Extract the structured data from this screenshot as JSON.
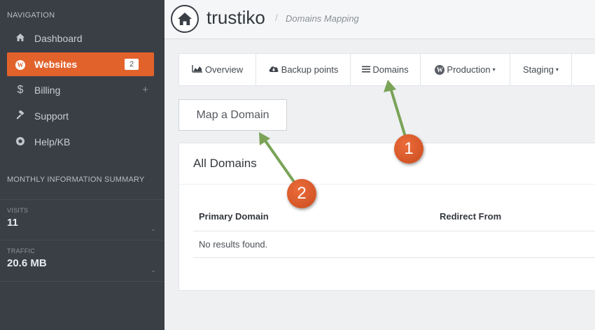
{
  "sidebar": {
    "nav_label": "NAVIGATION",
    "items": [
      {
        "label": "Dashboard",
        "icon": "home-icon"
      },
      {
        "label": "Websites",
        "icon": "wordpress-icon",
        "badge": "2",
        "active": true
      },
      {
        "label": "Billing",
        "icon": "dollar-icon",
        "extra": "+"
      },
      {
        "label": "Support",
        "icon": "gavel-icon"
      },
      {
        "label": "Help/KB",
        "icon": "help-icon"
      }
    ],
    "summary_label": "MONTHLY INFORMATION SUMMARY",
    "stats": [
      {
        "label": "VISITS",
        "value": "11",
        "trend": "-"
      },
      {
        "label": "TRAFFIC",
        "value": "20.6 MB",
        "trend": "-"
      }
    ]
  },
  "header": {
    "brand": "trustiko",
    "separator": "/",
    "breadcrumb": "Domains Mapping"
  },
  "tabs": [
    {
      "label": "Overview",
      "icon": "chart-icon"
    },
    {
      "label": "Backup points",
      "icon": "cloud-download-icon"
    },
    {
      "label": "Domains",
      "icon": "list-icon"
    },
    {
      "label": "Production",
      "icon": "wordpress-icon",
      "caret": "▾"
    },
    {
      "label": "Staging",
      "caret": "▾"
    }
  ],
  "map_button": "Map a Domain",
  "panel": {
    "title": "All Domains",
    "columns": [
      "Primary Domain",
      "Redirect From"
    ],
    "empty_text": "No results found."
  },
  "annotations": [
    {
      "number": "1",
      "color": "#e2622c"
    },
    {
      "number": "2",
      "color": "#e2622c"
    }
  ],
  "colors": {
    "sidebar_bg": "#3a3f46",
    "accent": "#e2622c",
    "arrow": "#7aa357"
  }
}
